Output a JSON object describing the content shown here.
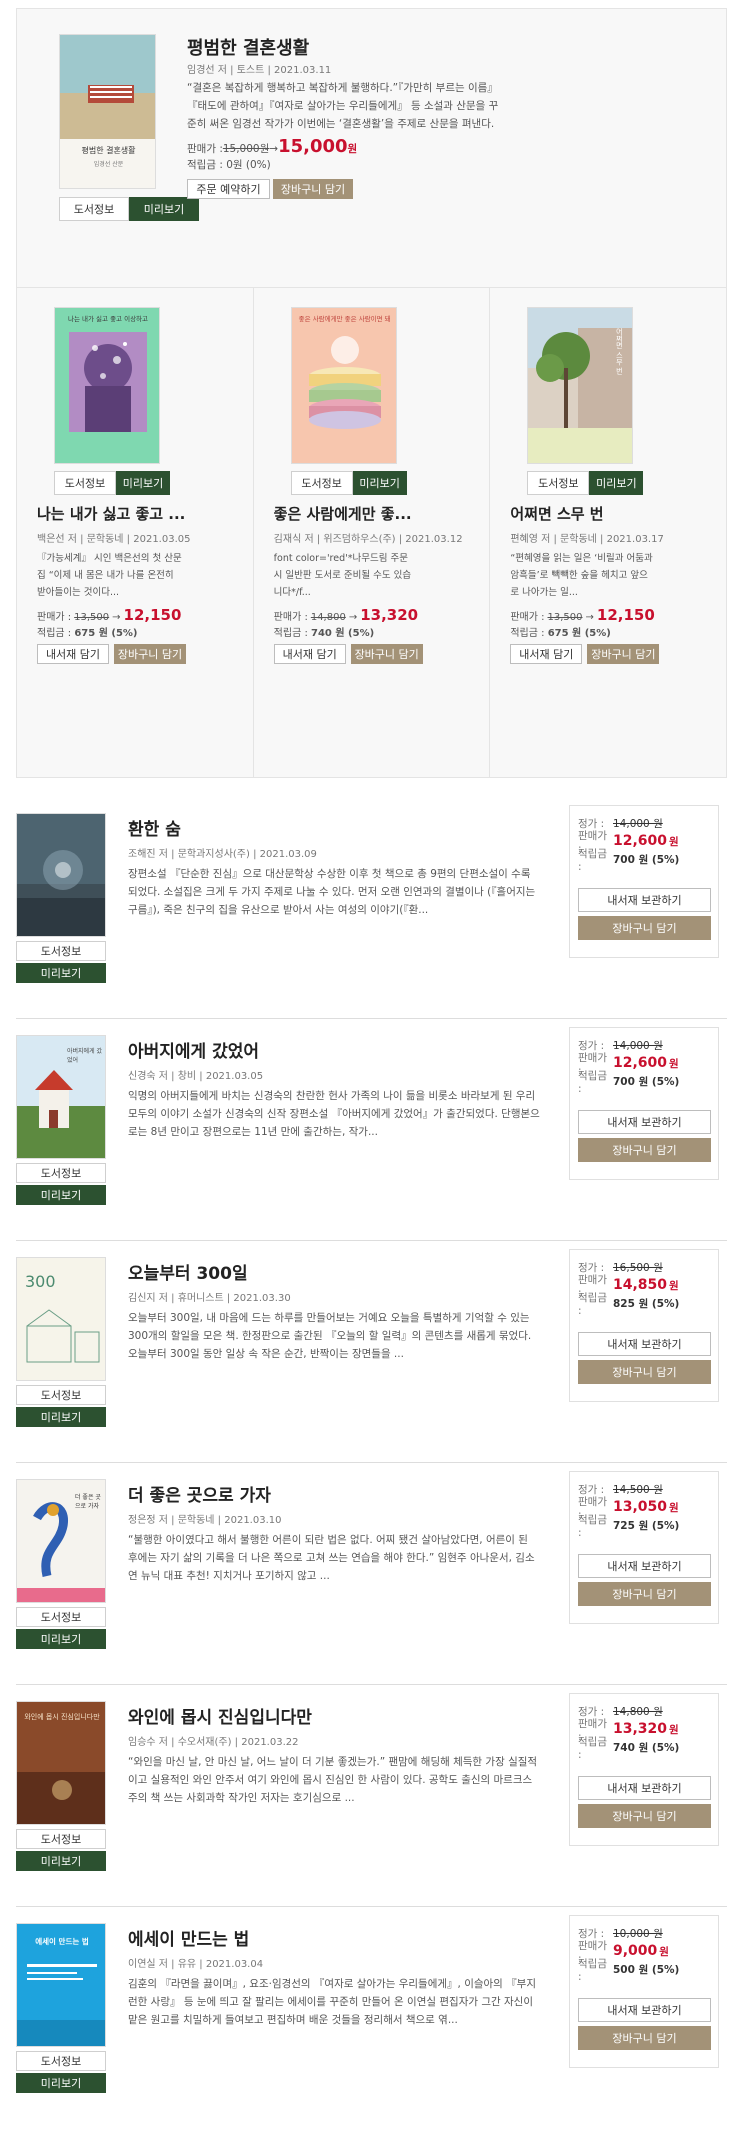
{
  "featured": {
    "title": "평범한 결혼생활",
    "meta": "임경선 저 | 토스트 | 2021.03.11",
    "desc": "“결혼은 복잡하게 행복하고 복잡하게 불행하다.”『가만히 부르는 이름』『태도에 관하여』『여자로 살아가는 우리들에게』 등 소설과 산문을 꾸준히 써온 임경선 작가가 이번에는 ‘결혼생활’을 주제로 산문을 펴낸다. “어쨌든 20년씩이나 한 남자와 결혼생활을 했으니...",
    "price_label": "판매가 :",
    "orig": "15,000원",
    "arrow": "→",
    "sale": "15,000",
    "won": "원",
    "points": "적립금 : 0원 (0%)",
    "reserve": "주문 예약하기",
    "cart": "장바구니 담기",
    "cover_title": "평범한 결혼생활",
    "cover_author": "임경선 산문"
  },
  "buttons": {
    "info": "도서정보",
    "preview": "미리보기",
    "shelf": "내서재 담기",
    "cart": "장바구니 담기",
    "keep": "내서재 보관하기"
  },
  "labels": {
    "list": "정가 :",
    "sale": "판매가 :",
    "points": "적립금 :",
    "price": "판매가 :",
    "pts": "적립금 :"
  },
  "grid": [
    {
      "title": "나는 내가 싫고 좋고 ...",
      "meta": "백은선 저 | 문학동네 | 2021.03.05",
      "desc": "『가능세계』 시인 백은선의 첫 산문집 “이제 내 몸은 내가 나를 온전히 받아들이는 것이다...",
      "orig": "13,500",
      "sale": "12,150",
      "points": "675 원 (5%)",
      "cover_text": "나는 내가 싫고 좋고 이상하고"
    },
    {
      "title": "좋은 사람에게만 좋...",
      "meta": "김재식 저 | 위즈덤하우스(주) | 2021.03.12",
      "desc": "font color='red'*나무드림 주문 시 일반판 도서로 준비될 수도 있습니다*/f...",
      "orig": "14,800",
      "sale": "13,320",
      "points": "740 원 (5%)",
      "cover_text": "좋은 사람에게만 좋은 사람이면 돼"
    },
    {
      "title": "어쩌면 스무 번",
      "meta": "편혜영 저 | 문학동네 | 2021.03.17",
      "desc": "“편혜영을 읽는 일은 ‘비릴과 어둠과 암흑들’로 빽빽한 숲을 헤치고 앞으로 나아가는 일...",
      "orig": "13,500",
      "sale": "12,150",
      "points": "675 원 (5%)",
      "cover_text": "어쩌면 스무 번"
    }
  ],
  "list": [
    {
      "title": "환한 숨",
      "meta": "조해진 저 | 문학과지성사(주) | 2021.03.09",
      "desc": "장편소설 『단순한 진심』으로 대산문학상 수상한 이후 첫 책으로 총 9편의 단편소설이 수록되었다. 소설집은 크게 두 가지 주제로 나눌 수 있다. 먼저 오랜 인연과의 결별이나 (『흘어지는 구름』), 죽은 친구의 집을 유산으로 받아서 사는 여성의 이야기(『환...",
      "list": "14,000 원",
      "sale": "12,600",
      "won": "원",
      "points": "700 원 (5%)"
    },
    {
      "title": "아버지에게 갔었어",
      "meta": "신경숙 저 | 창비 | 2021.03.05",
      "desc": "익명의 아버지들에게 바치는 신경숙의 찬란한 헌사 가족의 나이 듦을 비롯소 바라보게 된 우리 모두의 이야기 소설가 신경숙의 신작 장편소설 『아버지에게 갔었어』가 출간되었다. 단행본으로는 8년 만이고 장편으로는 11년 만에 출간하는, 작가...",
      "list": "14,000 원",
      "sale": "12,600",
      "won": "원",
      "points": "700 원 (5%)"
    },
    {
      "title": "오늘부터 300일",
      "meta": "김신지 저 | 휴머니스트 | 2021.03.30",
      "desc": "오늘부터 300일, 내 마음에 드는 하루를 만들어보는 거예요 오늘을 특별하게 기억할 수 있는 300개의 할일을 모은 책. 한정판으로 출간된 『오늘의 할 일력』의 콘텐츠를 새롭게 묶었다. 오늘부터 300일 동안 일상 속 작은 순간, 반짝이는 장면들을 ...",
      "list": "16,500 원",
      "sale": "14,850",
      "won": "원",
      "points": "825 원 (5%)"
    },
    {
      "title": "더 좋은 곳으로 가자",
      "meta": "정은정 저 | 문학동네 | 2021.03.10",
      "desc": "“불행한 아이였다고 해서 불행한 어른이 되란 법은 없다. 어찌 됐건 살아남았다면, 어른이 된 후에는 자기 삶의 기록을 더 나은 쪽으로 고쳐 쓰는 연습을 해야 한다.” 임현주 아나운서, 김소연 뉴닉 대표 추천! 지치거나 포기하지 않고 ...",
      "list": "14,500 원",
      "sale": "13,050",
      "won": "원",
      "points": "725 원 (5%)"
    },
    {
      "title": "와인에 몹시 진심입니다만",
      "meta": "임승수 저 | 수오서재(주) | 2021.03.22",
      "desc": "“와인을 마신 날, 안 마신 날, 어느 날이 더 기분 좋겠는가.” 팬맘에 해딩해 체득한 가장 실질적이고 실용적인 와인 안주서 여기 와인에 몹시 진심인 한 사람이 있다. 공학도 출신의 마르크스주의 책 쓰는 사회과학 작가인 저자는 호기심으로 ...",
      "list": "14,800 원",
      "sale": "13,320",
      "won": "원",
      "points": "740 원 (5%)"
    },
    {
      "title": "에세이 만드는 법",
      "meta": "이연실 저 | 유유 | 2021.03.04",
      "desc": "김훈의 『라면을 끓이며』, 요조·임경선의 『여자로 살아가는 우리들에게』, 이슬아의 『부지런한 사랑』 등 눈에 띄고 잘 팔리는 에세이를 꾸준히 만들어 온 이연실 편집자가 그간 자신이 맡은 원고를 치밀하게 들여보고 편집하며 배운 것들을 정리해서 책으로 엮...",
      "list": "10,000 원",
      "sale": "9,000",
      "won": "원",
      "points": "500 원 (5%)"
    }
  ],
  "covers": {
    "c1": "아버지에게 갔었어",
    "c2": "300",
    "c3": "더 좋은 곳으로 가자",
    "c4": "와인에 몹시 진심입니다만",
    "c5": "에세이 만드는 법"
  }
}
